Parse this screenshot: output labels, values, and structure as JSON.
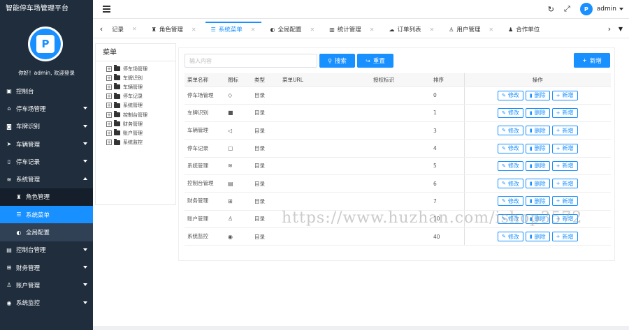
{
  "app": {
    "title": "智能停车场管理平台"
  },
  "sidebar": {
    "welcome": "你好！admin, 欢迎登录",
    "avatar_letter": "P",
    "items": [
      {
        "label": "控制台",
        "icon": "dashboard-icon",
        "caret": false
      },
      {
        "label": "停车场管理",
        "icon": "parking-icon",
        "caret": true
      },
      {
        "label": "车牌识别",
        "icon": "camera-icon",
        "caret": true
      },
      {
        "label": "车辆管理",
        "icon": "send-icon",
        "caret": true
      },
      {
        "label": "停车记录",
        "icon": "record-icon",
        "caret": true
      },
      {
        "label": "系统管理",
        "icon": "layers-icon",
        "caret": true,
        "expanded": true
      }
    ],
    "sub_items": [
      {
        "label": "角色管理",
        "icon": "shirt-icon"
      },
      {
        "label": "系统菜单",
        "icon": "menu-icon",
        "active": true
      },
      {
        "label": "全局配置",
        "icon": "config-icon"
      }
    ],
    "items_after": [
      {
        "label": "控制台管理",
        "icon": "panel-icon"
      },
      {
        "label": "财务管理",
        "icon": "finance-icon"
      },
      {
        "label": "账户管理",
        "icon": "user-icon"
      },
      {
        "label": "系统监控",
        "icon": "monitor-icon"
      }
    ]
  },
  "header": {
    "username": "admin",
    "avatar_text": "P"
  },
  "tabs": [
    {
      "label": "记录",
      "icon": "",
      "close": true
    },
    {
      "label": "角色管理",
      "icon": "shirt-icon",
      "close": true
    },
    {
      "label": "系统菜单",
      "icon": "menu-icon",
      "close": true,
      "active": true
    },
    {
      "label": "全局配置",
      "icon": "config-icon",
      "close": true
    },
    {
      "label": "统计管理",
      "icon": "stats-icon",
      "close": true
    },
    {
      "label": "订单列表",
      "icon": "order-icon",
      "close": true
    },
    {
      "label": "用户管理",
      "icon": "user-icon",
      "close": true
    },
    {
      "label": "合作单位",
      "icon": "partner-icon",
      "close": false
    }
  ],
  "tree": {
    "title": "菜单",
    "nodes": [
      "停车场管理",
      "车牌识别",
      "车辆管理",
      "停车记录",
      "系统管理",
      "控制台管理",
      "财务管理",
      "账户管理",
      "系统监控"
    ]
  },
  "toolbar": {
    "search_placeholder": "输入内容",
    "search_label": "搜索",
    "reset_label": "重置",
    "add_label": "新增"
  },
  "table": {
    "headers": [
      "菜单名称",
      "图标",
      "类型",
      "菜单URL",
      "授权标识",
      "排序",
      "操作"
    ],
    "rows": [
      {
        "name": "停车场管理",
        "icon": "◇",
        "type": "目录",
        "url": "",
        "perm": "",
        "sort": "0"
      },
      {
        "name": "车牌识别",
        "icon": "■",
        "type": "目录",
        "url": "",
        "perm": "",
        "sort": "1"
      },
      {
        "name": "车辆管理",
        "icon": "◁",
        "type": "目录",
        "url": "",
        "perm": "",
        "sort": "3"
      },
      {
        "name": "停车记录",
        "icon": "▢",
        "type": "目录",
        "url": "",
        "perm": "",
        "sort": "4"
      },
      {
        "name": "系统管理",
        "icon": "≋",
        "type": "目录",
        "url": "",
        "perm": "",
        "sort": "5"
      },
      {
        "name": "控制台管理",
        "icon": "▤",
        "type": "目录",
        "url": "",
        "perm": "",
        "sort": "6"
      },
      {
        "name": "财务管理",
        "icon": "⊞",
        "type": "目录",
        "url": "",
        "perm": "",
        "sort": "7"
      },
      {
        "name": "账户管理",
        "icon": "♙",
        "type": "目录",
        "url": "",
        "perm": "",
        "sort": "10"
      },
      {
        "name": "系统监控",
        "icon": "◉",
        "type": "目录",
        "url": "",
        "perm": "",
        "sort": "40"
      }
    ],
    "actions": {
      "edit": "修改",
      "delete": "删除",
      "add": "新增"
    }
  },
  "watermark": "https://www.huzhan.com/ishop3572"
}
